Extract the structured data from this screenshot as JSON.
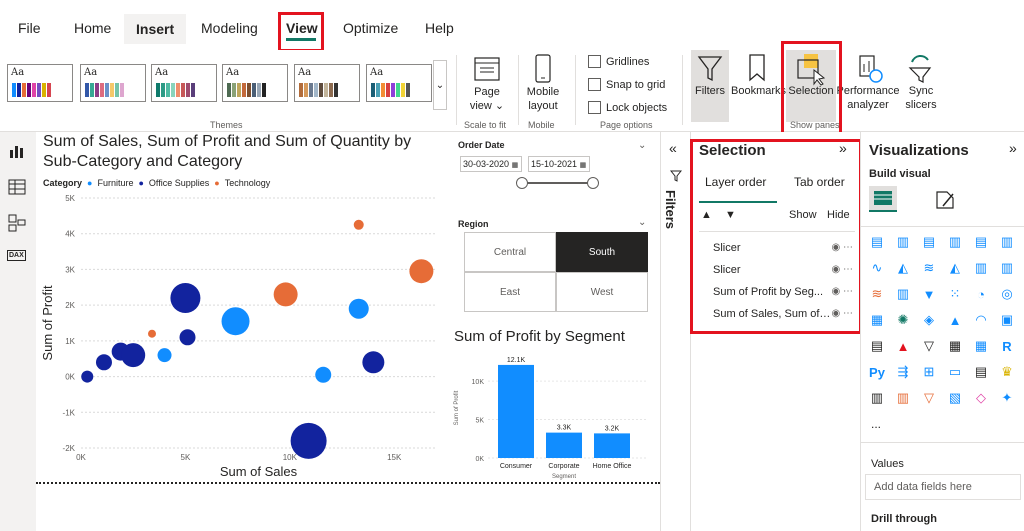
{
  "menu": {
    "tabs": [
      "File",
      "Home",
      "Insert",
      "Modeling",
      "View",
      "Optimize",
      "Help"
    ],
    "active": "Insert",
    "highlighted": "View"
  },
  "ribbon": {
    "themes_label": "Themes",
    "scale_group": "Scale to fit",
    "page_view": "Page view",
    "page_view_caret": "⌄",
    "mobile_group": "Mobile",
    "mobile_layout": "Mobile layout",
    "page_options_group": "Page options",
    "gridlines": "Gridlines",
    "snap_to_grid": "Snap to grid",
    "lock_objects": "Lock objects",
    "filters": "Filters",
    "bookmarks": "Bookmarks",
    "selection": "Selection",
    "performance_analyzer": "Performance analyzer",
    "sync_slicers": "Sync slicers",
    "show_panes_group": "Show panes"
  },
  "leftrail": {
    "report_icon": "bar-chart-icon",
    "data_icon": "table-icon",
    "model_icon": "model-icon",
    "dax_icon": "DAX"
  },
  "scatter": {
    "title": "Sum of Sales, Sum of Profit and Sum of Quantity by Sub-Category and Category",
    "legend_title": "Category",
    "legend": [
      {
        "name": "Furniture",
        "color": "#118dff"
      },
      {
        "name": "Office Supplies",
        "color": "#12239e"
      },
      {
        "name": "Technology",
        "color": "#e66c37"
      }
    ],
    "xlabel": "Sum of Sales",
    "ylabel": "Sum of Profit"
  },
  "slicer_date": {
    "title": "Order Date",
    "from": "30-03-2020",
    "to": "15-10-2021"
  },
  "slicer_region": {
    "title": "Region",
    "options": [
      "Central",
      "South",
      "East",
      "West"
    ],
    "selected": "South"
  },
  "bar": {
    "title": "Sum of Profit by Segment"
  },
  "filters_pane": {
    "label": "Filters"
  },
  "selection_pane": {
    "title": "Selection",
    "tabs": [
      "Layer order",
      "Tab order"
    ],
    "show": "Show",
    "hide": "Hide",
    "items": [
      "Slicer",
      "Slicer",
      "Sum of Profit by Seg...",
      "Sum of Sales, Sum of ..."
    ]
  },
  "viz_pane": {
    "title": "Visualizations",
    "build_visual": "Build visual",
    "more": "...",
    "values": "Values",
    "add_fields": "Add data fields here",
    "drill_through": "Drill through"
  },
  "chart_data": [
    {
      "type": "scatter",
      "title": "Sum of Sales, Sum of Profit and Sum of Quantity by Sub-Category and Category",
      "xlabel": "Sum of Sales",
      "ylabel": "Sum of Profit",
      "xlim": [
        0,
        17000
      ],
      "ylim": [
        -2000,
        5000
      ],
      "x_ticks": [
        "0K",
        "5K",
        "10K",
        "15K"
      ],
      "y_ticks": [
        "-2K",
        "-1K",
        "0K",
        "1K",
        "2K",
        "3K",
        "4K",
        "5K"
      ],
      "series": [
        {
          "name": "Furniture",
          "color": "#118dff",
          "points": [
            {
              "x": 4000,
              "y": 600,
              "size": 7
            },
            {
              "x": 7400,
              "y": 1550,
              "size": 14
            },
            {
              "x": 11600,
              "y": 50,
              "size": 8
            },
            {
              "x": 13300,
              "y": 1900,
              "size": 10
            }
          ]
        },
        {
          "name": "Office Supplies",
          "color": "#12239e",
          "points": [
            {
              "x": 300,
              "y": 0,
              "size": 6
            },
            {
              "x": 1100,
              "y": 400,
              "size": 8
            },
            {
              "x": 1900,
              "y": 700,
              "size": 9
            },
            {
              "x": 2500,
              "y": 600,
              "size": 12
            },
            {
              "x": 5100,
              "y": 1100,
              "size": 8
            },
            {
              "x": 5000,
              "y": 2200,
              "size": 15
            },
            {
              "x": 14000,
              "y": 400,
              "size": 11
            },
            {
              "x": 10900,
              "y": -1800,
              "size": 18
            }
          ]
        },
        {
          "name": "Technology",
          "color": "#e66c37",
          "points": [
            {
              "x": 3400,
              "y": 1200,
              "size": 4
            },
            {
              "x": 9800,
              "y": 2300,
              "size": 12
            },
            {
              "x": 13300,
              "y": 4250,
              "size": 5
            },
            {
              "x": 16300,
              "y": 2950,
              "size": 12
            }
          ]
        }
      ]
    },
    {
      "type": "bar",
      "title": "Sum of Profit by Segment",
      "xlabel": "Segment",
      "ylabel": "Sum of Profit",
      "categories": [
        "Consumer",
        "Corporate",
        "Home Office"
      ],
      "values": [
        12100,
        3300,
        3200
      ],
      "data_labels": [
        "12.1K",
        "3.3K",
        "3.2K"
      ],
      "ylim": [
        0,
        13000
      ],
      "y_ticks": [
        "0K",
        "5K",
        "10K"
      ],
      "color": "#118dff"
    }
  ]
}
